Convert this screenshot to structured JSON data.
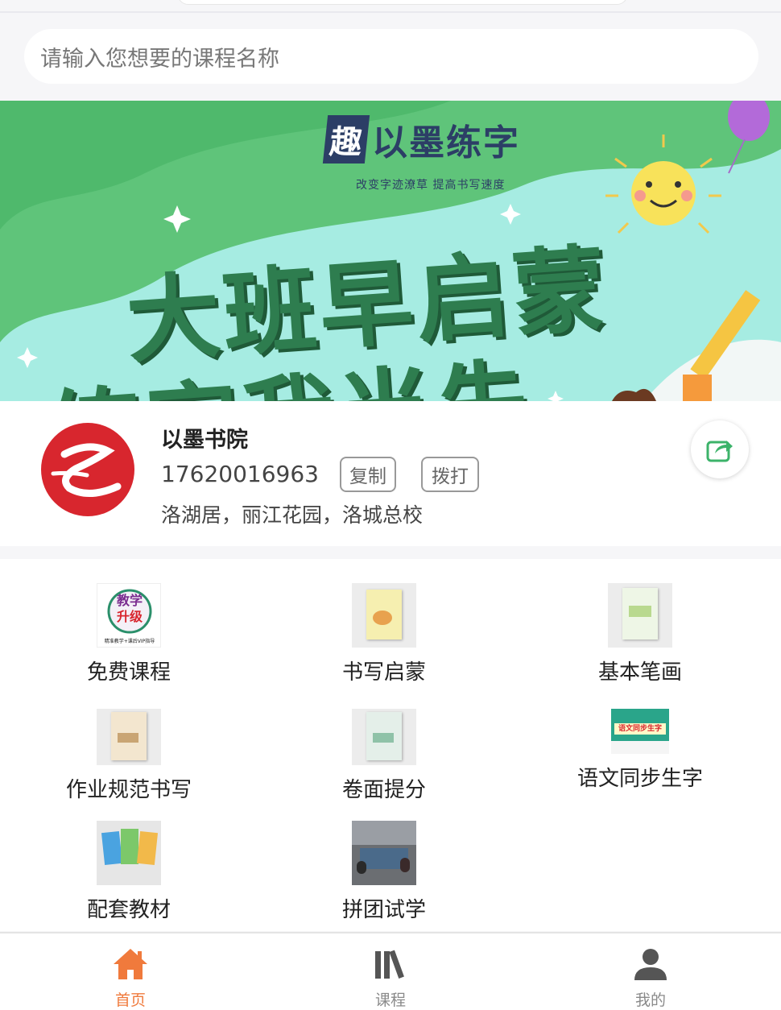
{
  "search": {
    "placeholder": "请输入您想要的课程名称"
  },
  "banner": {
    "brand_qu": "趣",
    "brand_rest": "以墨练字",
    "slogan": "改变字迹潦草  提高书写速度",
    "line1": "大班早启蒙",
    "line2": "练字我当先"
  },
  "store": {
    "name": "以墨书院",
    "phone": "17620016963",
    "copy_label": "复制",
    "call_label": "拨打",
    "address": "洛湖居，丽江花园，洛城总校"
  },
  "grid": {
    "items": [
      {
        "label": "免费课程",
        "thumb_text_1": "教学",
        "thumb_text_2": "升级",
        "thumb_caption": "精准教学+课后VIP指导"
      },
      {
        "label": "书写启蒙"
      },
      {
        "label": "基本笔画"
      },
      {
        "label": "作业规范书写"
      },
      {
        "label": "卷面提分"
      },
      {
        "label": "语文同步生字",
        "thumb_text_1": "语文同步生字"
      },
      {
        "label": "配套教材"
      },
      {
        "label": "拼团试学"
      }
    ]
  },
  "tabbar": {
    "items": [
      {
        "label": "首页",
        "active": true
      },
      {
        "label": "课程",
        "active": false
      },
      {
        "label": "我的",
        "active": false
      }
    ]
  },
  "colors": {
    "accent": "#f07a3c",
    "brand_green": "#2e7d4f",
    "share_green": "#3cb36a",
    "logo_red": "#d8262e"
  }
}
